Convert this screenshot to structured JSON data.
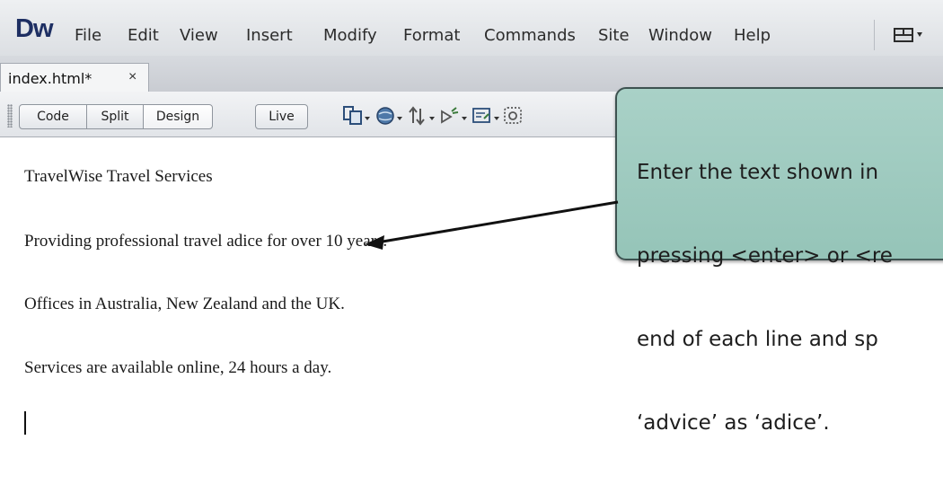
{
  "app": {
    "logo": "Dw"
  },
  "menu": {
    "items": [
      "File",
      "Edit",
      "View",
      "Insert",
      "Modify",
      "Format",
      "Commands",
      "Site",
      "Window",
      "Help"
    ]
  },
  "document_tab": {
    "label": "index.html*",
    "close": "×"
  },
  "toolbar": {
    "views": [
      "Code",
      "Split",
      "Design",
      "Live"
    ],
    "active_view": "Design",
    "icons": [
      "multiscreen-icon",
      "globe-preview-icon",
      "file-management-icon",
      "validate-icon",
      "visual-aids-icon",
      "live-view-eye-icon"
    ]
  },
  "content": {
    "paragraphs": [
      "TravelWise Travel Services",
      "Providing professional travel adice for over 10 years.",
      "Offices in Australia, New Zealand and the UK.",
      "Services are available online, 24 hours a day."
    ]
  },
  "callout": {
    "lines": [
      "Enter the text shown in",
      "pressing <enter> or <re",
      "end of each line and sp",
      "‘advice’ as ‘adice’."
    ],
    "color": "#a3cdc2"
  }
}
